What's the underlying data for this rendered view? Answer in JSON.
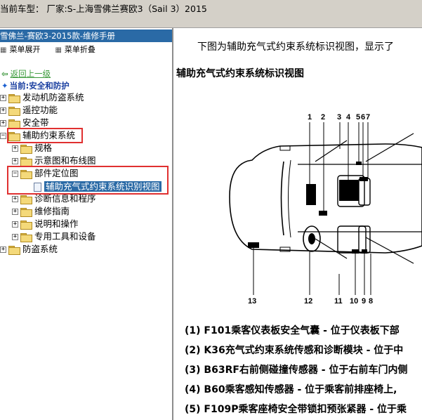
{
  "titlebar": {
    "text": "当前车型：  厂家:S-上海雪佛兰赛欧3（Sail 3）2015"
  },
  "left_panel": {
    "header": "雪佛兰-赛欧3-2015款-维修手册",
    "menu": {
      "expand": "菜单展开",
      "collapse": "菜单折叠"
    },
    "back": "返回上一级",
    "current": "当前:安全和防护",
    "tree": [
      {
        "label": "发动机防盗系统",
        "expander": "+"
      },
      {
        "label": "遥控功能",
        "expander": "+"
      },
      {
        "label": "安全带",
        "expander": "+"
      },
      {
        "label": "辅助约束系统",
        "expander": "−"
      },
      {
        "label": "规格",
        "expander": "+"
      },
      {
        "label": "示意图和布线图",
        "expander": "+"
      },
      {
        "label": "部件定位图",
        "expander": "−"
      },
      {
        "label": "辅助充气式约束系统识别视图",
        "expander": ""
      },
      {
        "label": "诊断信息和程序",
        "expander": "+"
      },
      {
        "label": "维修指南",
        "expander": "+"
      },
      {
        "label": "说明和操作",
        "expander": "+"
      },
      {
        "label": "专用工具和设备",
        "expander": "+"
      },
      {
        "label": "防盗系统",
        "expander": "+"
      }
    ]
  },
  "content": {
    "intro": "下图为辅助充气式约束系统标识视图，显示了",
    "section_title": "辅助充气式约束系统标识视图",
    "callouts": [
      "1",
      "2",
      "3",
      "4",
      "5",
      "6",
      "7",
      "9",
      "8",
      "10",
      "11",
      "12",
      "13"
    ],
    "legend": [
      "(1) F101乘客仪表板安全气囊 - 位于仪表板下部",
      "(2) K36充气式约束系统传感和诊断模块 - 位于中",
      "(3) B63RF右前侧碰撞传感器 - 位于右前车门内侧",
      "(4) B60乘客感知传感器 - 位于乘客前排座椅上,",
      "(5) F109P乘客座椅安全带锁扣预张紧器 - 位于乘"
    ]
  }
}
